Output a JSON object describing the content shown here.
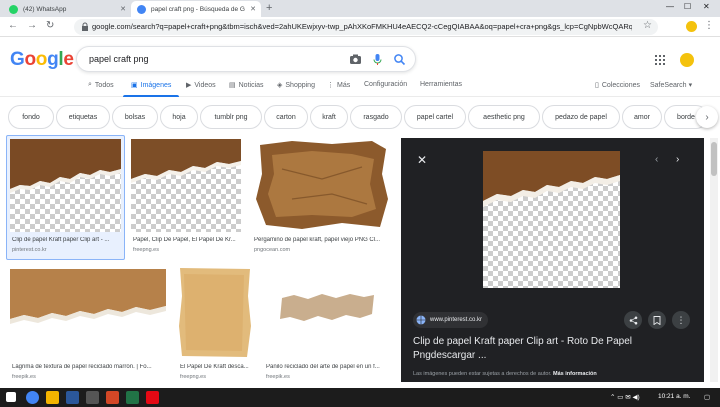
{
  "browser": {
    "tabs": [
      {
        "title": "(42) WhatsApp",
        "favicon_color": "#25d366"
      },
      {
        "title": "papel craft png - Búsqueda de G",
        "favicon_color": "#4285f4"
      }
    ],
    "new_tab": "+",
    "url": "google.com/search?q=papel+craft+png&tbm=isch&ved=2ahUKEwjxyv-twp_pAhXKoFMKHU4eAECQ2-cCegQIABAA&oq=papel+cra+png&gs_lcp=CgNpbWcQARqBMgIIAD..."
  },
  "google": {
    "logo_letters": [
      {
        "ch": "G",
        "color": "#4285f4"
      },
      {
        "ch": "o",
        "color": "#ea4335"
      },
      {
        "ch": "o",
        "color": "#fbbc05"
      },
      {
        "ch": "g",
        "color": "#4285f4"
      },
      {
        "ch": "l",
        "color": "#34a853"
      },
      {
        "ch": "e",
        "color": "#ea4335"
      }
    ],
    "query": "papel craft png",
    "nav_tabs": [
      {
        "label": "Todos",
        "icon": "search-icon",
        "active": false
      },
      {
        "label": "Imágenes",
        "icon": "image-icon",
        "active": true
      },
      {
        "label": "Videos",
        "icon": "video-icon",
        "active": false
      },
      {
        "label": "Noticias",
        "icon": "news-icon",
        "active": false
      },
      {
        "label": "Shopping",
        "icon": "tag-icon",
        "active": false
      },
      {
        "label": "Más",
        "icon": "more-icon",
        "active": false
      }
    ],
    "settings_label": "Configuración",
    "tools_label": "Herramientas",
    "collections_label": "Colecciones",
    "safesearch_label": "SafeSearch",
    "chips": [
      "fondo",
      "etiquetas",
      "bolsas",
      "hoja",
      "tumblr png",
      "carton",
      "kraft",
      "rasgado",
      "papel cartel",
      "aesthetic png",
      "pedazo de papel",
      "amor",
      "borde"
    ]
  },
  "results": [
    {
      "title": "Clip de papel Kraft paper Clip art - ...",
      "source": "pinterest.co.kr",
      "selected": true
    },
    {
      "title": "Papel, Clip De Papel, El Papel De Kr...",
      "source": "freepng.es",
      "selected": false
    },
    {
      "title": "Pergamino de papel kraft, papel viejo PNG Cl...",
      "source": "pngocean.com",
      "selected": false
    },
    {
      "title": "Lágrima de textura de papel reciclado marrón. | Fo...",
      "source": "freepik.es",
      "selected": false
    },
    {
      "title": "El Papel De Kraft desca...",
      "source": "freepng.es",
      "selected": false
    },
    {
      "title": "Pañilo reciclado del arte de papel en un f...",
      "source": "freepik.es",
      "selected": false
    }
  ],
  "panel": {
    "source": "www.pinterest.co.kr",
    "title": "Clip de papel Kraft paper Clip art - Roto De Papel Pngdescargar ...",
    "note": "Las imágenes pueden estar sujetas a derechos de autor.",
    "more_info": "Más información"
  },
  "taskbar": {
    "clock": "10:21 a. m."
  },
  "colors": {
    "accent": "#1a73e8",
    "kraft_brown": "#8b5a2b",
    "panel_bg": "#202124"
  }
}
